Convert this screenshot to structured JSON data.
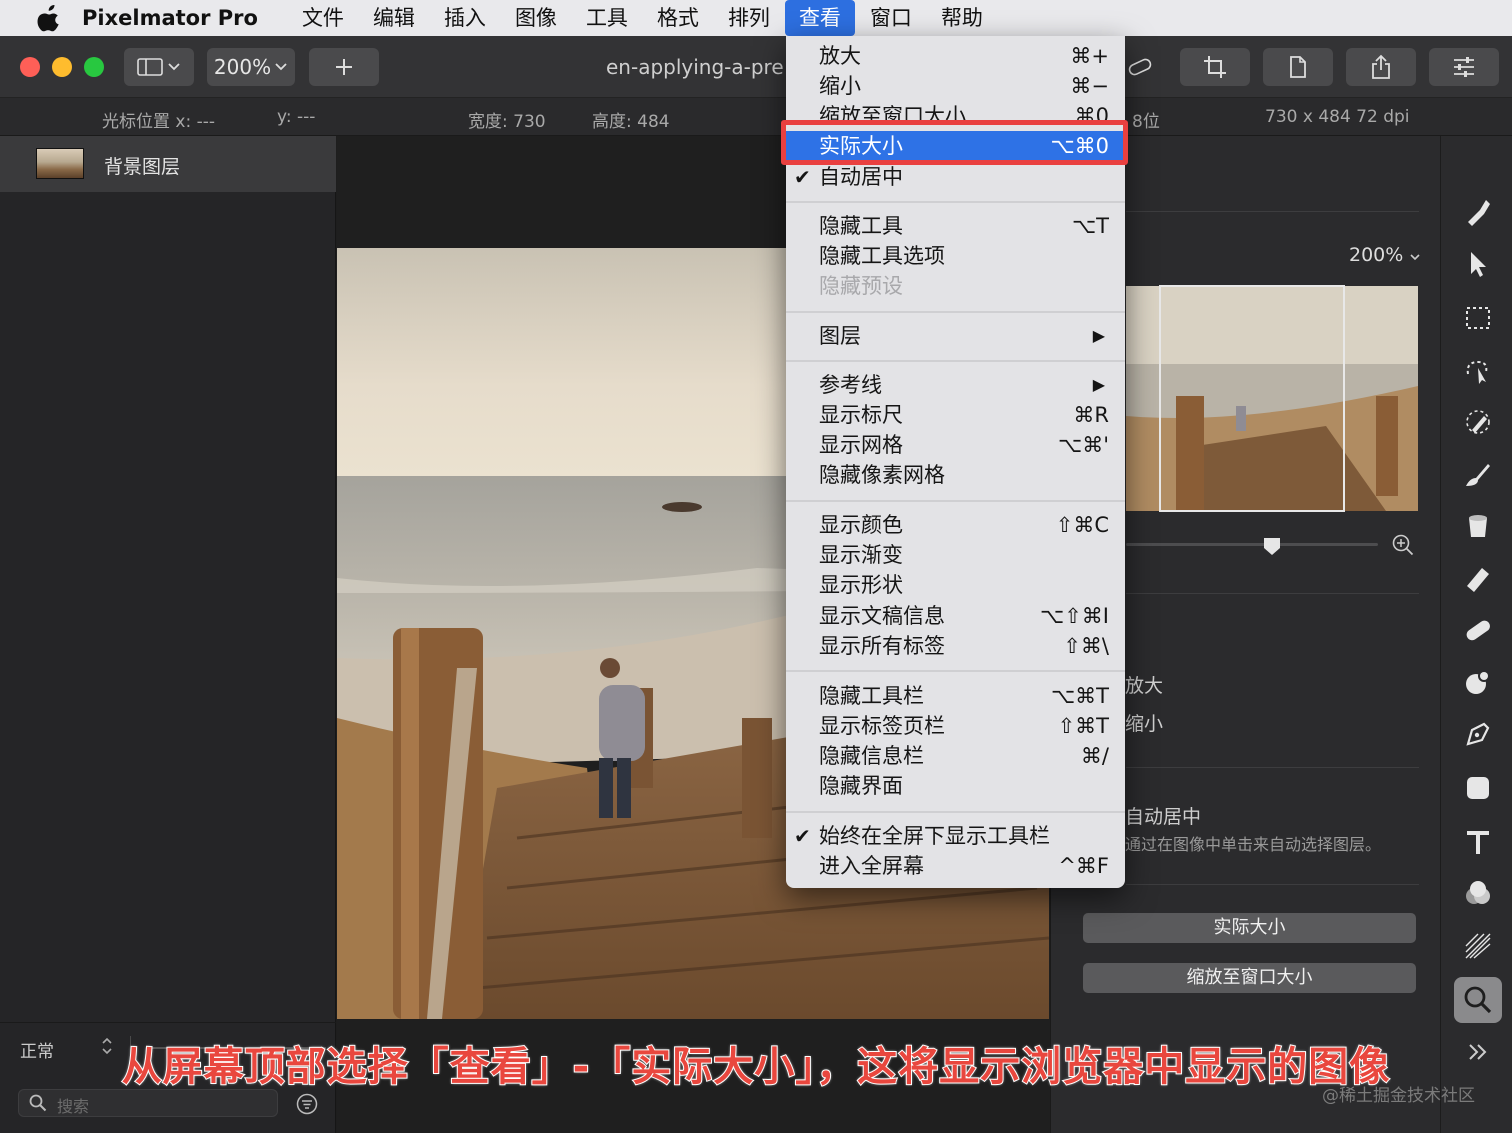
{
  "menubar": {
    "app_name": "Pixelmator Pro",
    "items": [
      "文件",
      "编辑",
      "插入",
      "图像",
      "工具",
      "格式",
      "排列",
      "查看",
      "窗口",
      "帮助"
    ],
    "active": "查看"
  },
  "toolbar": {
    "zoom_value": "200%",
    "doc_title": "en-applying-a-pre"
  },
  "infobar": {
    "cursor_x": "光标位置 x: ---",
    "cursor_y": "y: ---",
    "width": "宽度: 730",
    "height": "高度: 484",
    "bits": "8位",
    "dims": "730 x 484 72 dpi"
  },
  "layers": {
    "items": [
      {
        "name": "背景图层"
      }
    ],
    "blend_mode": "正常",
    "search_placeholder": "搜索"
  },
  "view_menu": {
    "items": [
      {
        "label": "放大",
        "shortcut": "⌘+"
      },
      {
        "label": "缩小",
        "shortcut": "⌘−"
      },
      {
        "label": "缩放至窗口大小",
        "shortcut": "⌘0"
      },
      {
        "label": "实际大小",
        "shortcut": "⌥⌘0",
        "highlighted": true
      },
      {
        "label": "自动居中",
        "checked": true
      },
      {
        "label": "隐藏工具",
        "shortcut": "⌥T"
      },
      {
        "label": "隐藏工具选项"
      },
      {
        "label": "隐藏预设",
        "disabled": true
      },
      {
        "label": "图层",
        "submenu": true
      },
      {
        "label": "参考线",
        "submenu": true
      },
      {
        "label": "显示标尺",
        "shortcut": "⌘R"
      },
      {
        "label": "显示网格",
        "shortcut": "⌥⌘'"
      },
      {
        "label": "隐藏像素网格"
      },
      {
        "label": "显示颜色",
        "shortcut": "⇧⌘C"
      },
      {
        "label": "显示渐变"
      },
      {
        "label": "显示形状"
      },
      {
        "label": "显示文稿信息",
        "shortcut": "⌥⇧⌘I"
      },
      {
        "label": "显示所有标签",
        "shortcut": "⇧⌘\\"
      },
      {
        "label": "隐藏工具栏",
        "shortcut": "⌥⌘T"
      },
      {
        "label": "显示标签页栏",
        "shortcut": "⇧⌘T"
      },
      {
        "label": "隐藏信息栏",
        "shortcut": "⌘/"
      },
      {
        "label": "隐藏界面"
      },
      {
        "label": "始终在全屏下显示工具栏",
        "checked": true
      },
      {
        "label": "进入全屏幕",
        "shortcut": "^⌘F"
      }
    ]
  },
  "zoom_panel": {
    "zoom_value": "200%",
    "zoom_in_label": "放大",
    "zoom_out_label": "缩小",
    "auto_center_title": "自动居中",
    "auto_center_hint": "通过在图像中单击来自动选择图层。",
    "actual_size_button": "实际大小",
    "fit_window_button": "缩放至窗口大小"
  },
  "tools": [
    "style-tool",
    "arrange-tool",
    "selection-tool",
    "quick-selection-tool",
    "color-picker-tool",
    "paint-tool",
    "fill-tool",
    "erase-tool",
    "retouch-tool",
    "distort-tool",
    "pen-tool",
    "shape-tool",
    "type-tool",
    "color-adjust-tool",
    "effects-tool",
    "zoom-tool"
  ],
  "caption": "从屏幕顶部选择「查看」-「实际大小」，这将显示浏览器中显示的图像",
  "watermark": "@稀土掘金技术社区",
  "colors": {
    "menu_highlight": "#2e72e6",
    "annotation_red": "#e94040",
    "caption_red": "#e9473e"
  }
}
